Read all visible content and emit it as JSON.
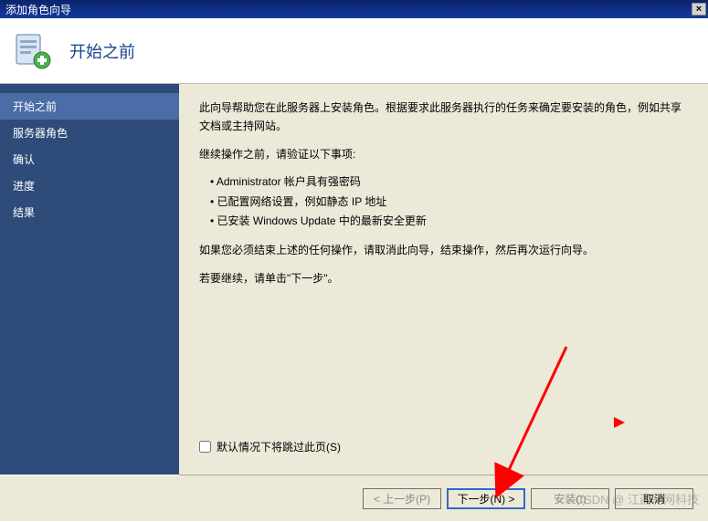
{
  "window": {
    "title": "添加角色向导",
    "close_label": "×"
  },
  "header": {
    "title": "开始之前"
  },
  "sidebar": {
    "items": [
      {
        "label": "开始之前",
        "active": true
      },
      {
        "label": "服务器角色",
        "active": false
      },
      {
        "label": "确认",
        "active": false
      },
      {
        "label": "进度",
        "active": false
      },
      {
        "label": "结果",
        "active": false
      }
    ]
  },
  "content": {
    "intro": "此向导帮助您在此服务器上安装角色。根据要求此服务器执行的任务来确定要安装的角色，例如共享文档或主持网站。",
    "verify_heading": "继续操作之前，请验证以下事项:",
    "bullets": [
      "Administrator 帐户具有强密码",
      "已配置网络设置，例如静态 IP 地址",
      "已安装 Windows Update 中的最新安全更新"
    ],
    "cancel_note": "如果您必须结束上述的任何操作，请取消此向导，结束操作，然后再次运行向导。",
    "continue_note": "若要继续，请单击\"下一步\"。",
    "skip_checkbox_label": "默认情况下将跳过此页(S)"
  },
  "footer": {
    "prev_label": "< 上一步(P)",
    "next_label": "下一步(N) >",
    "install_label": "安装(I)",
    "cancel_label": "取消"
  },
  "watermark": "CSDN @ 江西驰网科技"
}
